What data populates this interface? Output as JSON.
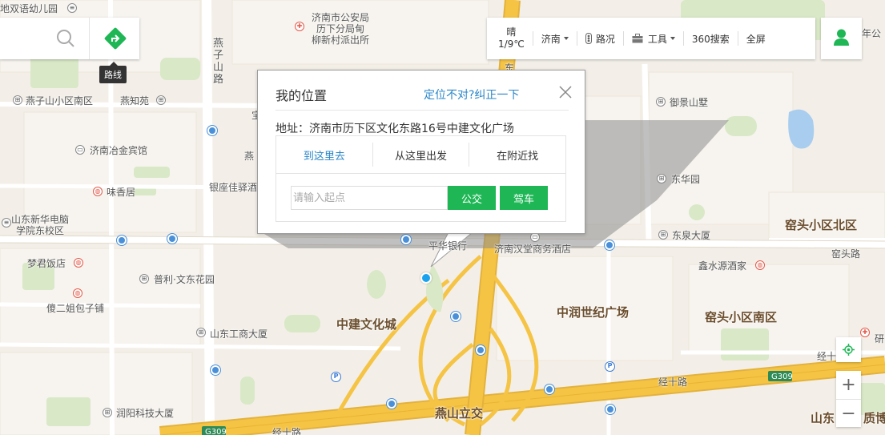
{
  "search": {
    "route_label": "路线"
  },
  "toolbar": {
    "weather_condition": "晴",
    "weather_temp": "1/9℃",
    "city": "济南",
    "traffic": "路况",
    "tools": "工具",
    "search360": "360搜索",
    "fullscreen": "全屏"
  },
  "popup": {
    "title": "我的位置",
    "correct_link": "定位不对?纠正一下",
    "address": "地址：济南市历下区文化东路16号中建文化广场",
    "tabs": [
      "到这里去",
      "从这里出发",
      "在附近找"
    ],
    "start_placeholder": "请输入起点",
    "bus_button": "公交",
    "drive_button": "驾车"
  },
  "map": {
    "labels": [
      "地双语幼儿园",
      "燕子山小区南区",
      "燕知苑",
      "济南市公安局",
      "历下分局甸",
      "柳新村派出所",
      "济南冶金宾馆",
      "味香居",
      "银座佳驿酒",
      "山东新华电脑",
      "学院东校区",
      "梦君饭店",
      "普利·文东花园",
      "傻二姐包子铺",
      "山东工商大厦",
      "润阳科技大厦",
      "中建文化城",
      "燕山立交",
      "中润世纪广场",
      "窑头小区南区",
      "窑头小区北区",
      "窑头路",
      "东泉大厦",
      "鑫水源酒家",
      "东华园",
      "御景山墅",
      "济南汉堂商务酒店",
      "平华银行",
      "经十路",
      "G309",
      "年公",
      "质博",
      "山东",
      "研",
      "宝",
      "燕",
      "东"
    ],
    "road_vertical": "燕子山路"
  },
  "controls": {
    "zoom_in": "+",
    "zoom_out": "−"
  },
  "colors": {
    "accent_green": "#1fb756",
    "link_blue": "#2a86c8",
    "location_blue": "#1aa2ee",
    "highway_yellow": "#f5c445"
  }
}
